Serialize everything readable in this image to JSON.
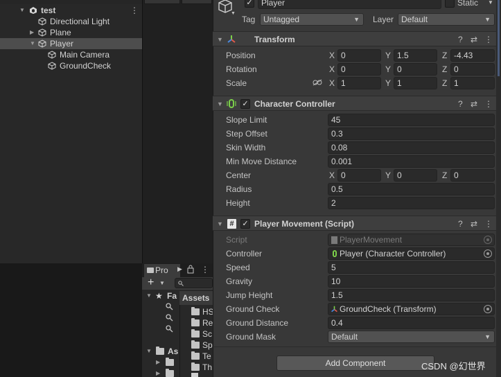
{
  "hierarchy": {
    "items": [
      {
        "label": "test",
        "level": 0,
        "expanded": true,
        "icon": "unity-scene-icon"
      },
      {
        "label": "Directional Light",
        "level": 1,
        "icon": "gameobject-cube-icon"
      },
      {
        "label": "Plane",
        "level": 1,
        "expandable": true,
        "icon": "gameobject-cube-icon"
      },
      {
        "label": "Player",
        "level": 1,
        "expanded": true,
        "selected": true,
        "icon": "gameobject-cube-icon"
      },
      {
        "label": "Main Camera",
        "level": 2,
        "icon": "gameobject-cube-icon"
      },
      {
        "label": "GroundCheck",
        "level": 2,
        "icon": "gameobject-cube-icon"
      }
    ],
    "menu_icon": "kebab-menu-icon"
  },
  "project": {
    "tab_label": "Pro",
    "assets_header": "Assets",
    "favorites_label": "Fa",
    "assets_tree_label": "As",
    "files": [
      "HS",
      "Re",
      "Sc",
      "Sp",
      "Te",
      "Th"
    ]
  },
  "inspector": {
    "object_name": "Player",
    "static_label": "Static",
    "tag_label": "Tag",
    "tag_value": "Untagged",
    "layer_label": "Layer",
    "layer_value": "Default",
    "transform": {
      "title": "Transform",
      "position_label": "Position",
      "rotation_label": "Rotation",
      "scale_label": "Scale",
      "position": {
        "x": "0",
        "y": "1.5",
        "z": "-4.43"
      },
      "rotation": {
        "x": "0",
        "y": "0",
        "z": "0"
      },
      "scale": {
        "x": "1",
        "y": "1",
        "z": "1"
      }
    },
    "character_controller": {
      "title": "Character Controller",
      "fields": [
        {
          "label": "Slope Limit",
          "value": "45"
        },
        {
          "label": "Step Offset",
          "value": "0.3"
        },
        {
          "label": "Skin Width",
          "value": "0.08"
        },
        {
          "label": "Min Move Distance",
          "value": "0.001"
        }
      ],
      "center_label": "Center",
      "center": {
        "x": "0",
        "y": "0",
        "z": "0"
      },
      "radius_label": "Radius",
      "radius": "0.5",
      "height_label": "Height",
      "height": "2"
    },
    "player_movement": {
      "title": "Player Movement (Script)",
      "script_label": "Script",
      "script_value": "PlayerMovement",
      "controller_label": "Controller",
      "controller_value": "Player (Character Controller)",
      "speed_label": "Speed",
      "speed": "5",
      "gravity_label": "Gravity",
      "gravity": "10",
      "jump_label": "Jump Height",
      "jump": "1.5",
      "ground_check_label": "Ground Check",
      "ground_check_value": "GroundCheck (Transform)",
      "ground_distance_label": "Ground Distance",
      "ground_distance": "0.4",
      "ground_mask_label": "Ground Mask",
      "ground_mask": "Default"
    },
    "add_component": "Add Component",
    "axis": {
      "x": "X",
      "y": "Y",
      "z": "Z"
    }
  },
  "watermark": "CSDN @幻世界",
  "colors": {
    "selection": "#4d4d4d",
    "panel": "#282828",
    "inspector": "#383838",
    "field": "#2a2a2a",
    "accent_green": "#7cd04a"
  }
}
